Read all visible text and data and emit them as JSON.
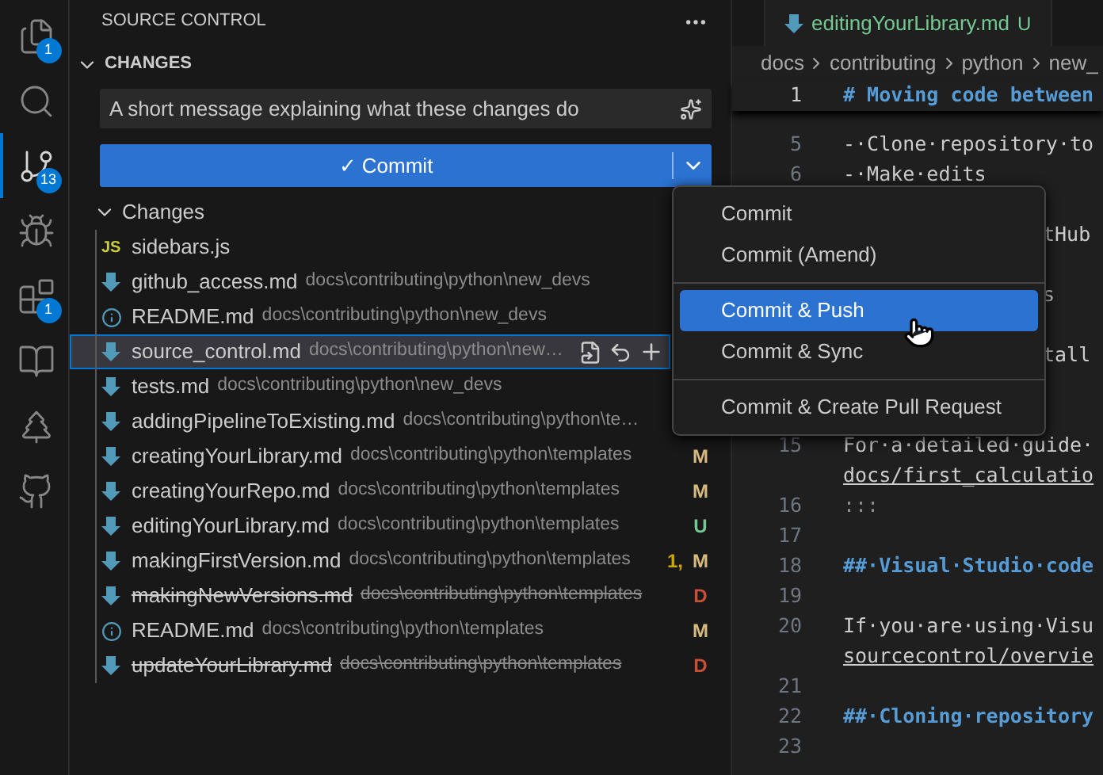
{
  "activity_bar": [
    {
      "kind": "files",
      "badge": "1",
      "selected": false
    },
    {
      "kind": "search",
      "selected": false
    },
    {
      "kind": "source_control",
      "badge": "13",
      "selected": true
    },
    {
      "kind": "run_debug",
      "selected": false
    },
    {
      "kind": "extensions",
      "badge": "1",
      "selected": false
    },
    {
      "kind": "book",
      "selected": false
    },
    {
      "kind": "tree",
      "selected": false
    },
    {
      "kind": "github",
      "selected": false
    }
  ],
  "sidebar": {
    "title": "SOURCE CONTROL",
    "section": "CHANGES",
    "message": {
      "placeholder": "A short message explaining what these changes do"
    },
    "commit_button": "✓ Commit",
    "group": "Changes",
    "files": [
      {
        "kind": "js",
        "icon": "JS",
        "name": "sidebars.js",
        "selected": false
      },
      {
        "kind": "markdown",
        "name": "github_access.md",
        "path": "docs\\contributing\\python\\new_devs",
        "selected": false
      },
      {
        "kind": "info",
        "name": "README.md",
        "path": "docs\\contributing\\python\\new_devs",
        "selected": false
      },
      {
        "kind": "markdown",
        "name": "source_control.md",
        "path": "docs\\contributing\\python\\new…",
        "selected": true
      },
      {
        "kind": "markdown",
        "name": "tests.md",
        "path": "docs\\contributing\\python\\new_devs",
        "selected": false
      },
      {
        "kind": "markdown",
        "name": "addingPipelineToExisting.md",
        "path": "docs\\contributing\\python\\te…",
        "selected": false
      },
      {
        "kind": "markdown",
        "name": "creatingYourLibrary.md",
        "path": "docs\\contributing\\python\\templates",
        "status": "M",
        "color": "#d7ba7d",
        "deleted": false,
        "selected": false
      },
      {
        "kind": "markdown",
        "name": "creatingYourRepo.md",
        "path": "docs\\contributing\\python\\templates",
        "status": "M",
        "color": "#d7ba7d",
        "deleted": false,
        "selected": false
      },
      {
        "kind": "markdown",
        "name": "editingYourLibrary.md",
        "path": "docs\\contributing\\python\\templates",
        "status": "U",
        "color": "#73c991",
        "deleted": false,
        "selected": false
      },
      {
        "kind": "markdown",
        "name": "makingFirstVersion.md",
        "path": "docs\\contributing\\python\\templates",
        "problems": "1,",
        "status": "M",
        "color": "#d7ba7d",
        "deleted": false,
        "selected": false
      },
      {
        "kind": "markdown",
        "name": "makingNewVersions.md",
        "path": "docs\\contributing\\python\\templates",
        "status": "D",
        "color": "#c74e39",
        "deleted": true,
        "selected": false
      },
      {
        "kind": "info",
        "name": "README.md",
        "path": "docs\\contributing\\python\\templates",
        "status": "M",
        "color": "#d7ba7d",
        "deleted": false,
        "selected": false
      },
      {
        "kind": "markdown",
        "name": "updateYourLibrary.md",
        "path": "docs\\contributing\\python\\templates",
        "status": "D",
        "color": "#c74e39",
        "deleted": true,
        "selected": false
      }
    ]
  },
  "menu": [
    [
      {
        "label": "Commit",
        "selected": false
      },
      {
        "label": "Commit (Amend)",
        "selected": false
      }
    ],
    [
      {
        "label": "Commit & Push",
        "selected": true
      },
      {
        "label": "Commit & Sync",
        "selected": false
      }
    ],
    [
      {
        "label": "Commit & Create Pull Request",
        "selected": false
      }
    ]
  ],
  "editor": {
    "tab": {
      "name": "editingYourLibrary.md",
      "status": "U"
    },
    "breadcrumbs": [
      "docs",
      "contributing",
      "python",
      "new_"
    ],
    "sticky": {
      "number": "1",
      "text": "# Moving code between"
    },
    "lines": [
      {
        "number": "5",
        "kind": "text",
        "text": "-·Clone·repository·to"
      },
      {
        "number": "6",
        "kind": "text",
        "text": "-·Make·edits"
      },
      {
        "kind": "blank"
      },
      {
        "kind": "covered",
        "text": "tHub"
      },
      {
        "kind": "blank"
      },
      {
        "kind": "covered",
        "text": "s"
      },
      {
        "kind": "blank"
      },
      {
        "kind": "covered",
        "text": "tall"
      },
      {
        "kind": "blank"
      },
      {
        "kind": "blank"
      },
      {
        "number": "15",
        "kind": "text",
        "text": "For·a·detailed·guide·"
      },
      {
        "kind": "link",
        "text": "docs/first_calculatio"
      },
      {
        "number": "16",
        "kind": "muted",
        "text": ":::"
      },
      {
        "number": "17",
        "kind": "text"
      },
      {
        "number": "18",
        "kind": "heading",
        "text": "##·Visual·Studio·code"
      },
      {
        "number": "19",
        "kind": "text"
      },
      {
        "number": "20",
        "kind": "text",
        "text": "If·you·are·using·Visu"
      },
      {
        "kind": "link",
        "text": "sourcecontrol/overvie"
      },
      {
        "number": "21",
        "kind": "text"
      },
      {
        "number": "22",
        "kind": "heading",
        "text": "##·Cloning·repository"
      },
      {
        "number": "23",
        "kind": "text"
      }
    ]
  }
}
